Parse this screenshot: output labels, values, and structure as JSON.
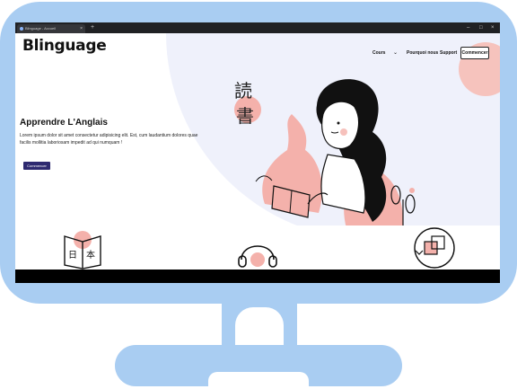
{
  "browser": {
    "tab_title": "Blinguage - Accueil",
    "tab_close": "×",
    "new_tab": "+",
    "minimize": "–",
    "maximize": "□",
    "close": "×"
  },
  "site": {
    "logo": "Blinguage",
    "nav": {
      "cours": "Cours",
      "cours_arrow": "⌄",
      "pourquoi": "Pourquoi nous",
      "support": "Support",
      "cta": "Commencer"
    },
    "hero": {
      "title": "Apprendre L'Anglais",
      "description": "Lorem ipsum dolor sit amet consectetur adipisicing elit. Est, cum laudantium dolores quae facilis mollitia laboriosam impedit ad qui numquam !",
      "button": "Commencer"
    },
    "kanji": {
      "top": "読",
      "bottom": "書"
    },
    "features": {
      "book_kanji_left": "日",
      "book_kanji_right": "本"
    }
  },
  "colors": {
    "monitor": "#a9cdf2",
    "accent_pink": "#f6c3bd",
    "button_blue": "#2e2a70",
    "bg_lavender": "#eff1fb"
  },
  "icons": [
    "book-icon",
    "headphones-icon",
    "translate-icon",
    "plant-icon"
  ]
}
